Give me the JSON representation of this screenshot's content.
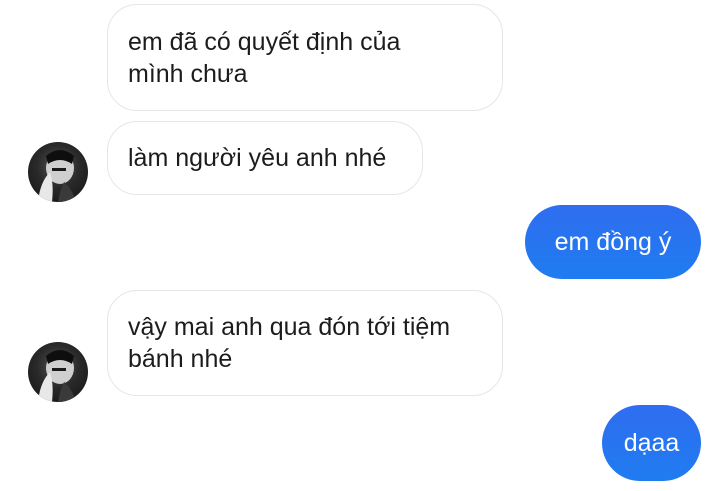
{
  "messages": [
    {
      "direction": "incoming",
      "text": "em đã có quyết định của\nmình chưa"
    },
    {
      "direction": "incoming",
      "text": "làm người yêu anh nhé"
    },
    {
      "direction": "outgoing",
      "text": "em đồng ý"
    },
    {
      "direction": "incoming",
      "text": "vậy mai anh qua đón tới tiệm\nbánh nhé"
    },
    {
      "direction": "outgoing",
      "text": "dạaa"
    }
  ],
  "avatars": [
    {
      "icon": "profile-photo"
    },
    {
      "icon": "profile-photo"
    }
  ],
  "colors": {
    "outgoing_gradient_top": "#2f6df0",
    "outgoing_gradient_bottom": "#1f7cf0",
    "incoming_border": "#e6e6e6"
  }
}
